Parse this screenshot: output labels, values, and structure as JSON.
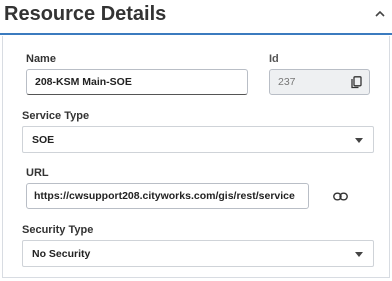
{
  "header": {
    "title": "Resource Details",
    "collapse_icon": "chevron-up-icon"
  },
  "form": {
    "name": {
      "label": "Name",
      "value": "208-KSM Main-SOE"
    },
    "id": {
      "label": "Id",
      "value": "237",
      "copy_icon": "copy-icon"
    },
    "service_type": {
      "label": "Service Type",
      "value": "SOE"
    },
    "url": {
      "label": "URL",
      "value": "https://cwsupport208.cityworks.com/gis/rest/service",
      "link_icon": "link-icon"
    },
    "security_type": {
      "label": "Security Type",
      "value": "No Security"
    }
  },
  "colors": {
    "accent": "#3b7bbf",
    "border": "#b9bec6",
    "readonly_bg": "#eef0f2"
  }
}
